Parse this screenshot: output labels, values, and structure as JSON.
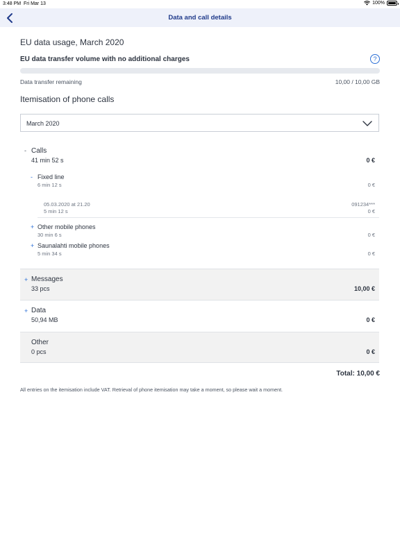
{
  "status": {
    "time": "3:48 PM",
    "date": "Fri Mar 13",
    "battery": "100%"
  },
  "header": {
    "title": "Data and call details"
  },
  "usage": {
    "heading": "EU data usage, March 2020",
    "subheading": "EU data transfer volume with no additional charges",
    "help_label": "?",
    "remaining_label": "Data transfer remaining",
    "remaining_value": "10,00 / 10,00 GB",
    "remaining_fraction": 1.0
  },
  "itemisation": {
    "heading": "Itemisation of phone calls",
    "month_selected": "March 2020"
  },
  "calls": {
    "toggle": "-",
    "label": "Calls",
    "duration": "41 min 52 s",
    "amount": "0 €",
    "fixed": {
      "toggle": "-",
      "label": "Fixed line",
      "duration": "6 min 12 s",
      "amount": "0 €",
      "entry": {
        "datetime": "05.03.2020 at 21.20",
        "duration": "5 min 12 s",
        "number": "091234***",
        "amount": "0 €"
      }
    },
    "other_mobile": {
      "toggle": "+",
      "label": "Other mobile phones",
      "duration": "30 min 6 s",
      "amount": "0 €"
    },
    "saunalahti": {
      "toggle": "+",
      "label": "Saunalahti mobile phones",
      "duration": "5 min 34 s",
      "amount": "0 €"
    }
  },
  "messages": {
    "toggle": "+",
    "label": "Messages",
    "count": "33 pcs",
    "amount": "10,00 €"
  },
  "data": {
    "toggle": "+",
    "label": "Data",
    "volume": "50,94 MB",
    "amount": "0 €"
  },
  "other": {
    "label": "Other",
    "count": "0 pcs",
    "amount": "0 €"
  },
  "total": "Total: 10,00 €",
  "footnote": "All entries on the itemisation include VAT. Retrieval of phone itemisation may take a moment, so please wait a moment.",
  "colors": {
    "accent": "#2b6fd6",
    "header_bg": "#eef1fa",
    "title": "#1f3a8a",
    "shaded": "#f2f2f2"
  }
}
